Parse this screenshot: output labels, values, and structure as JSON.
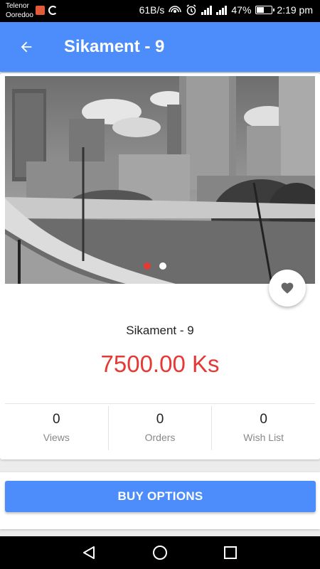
{
  "status_bar": {
    "carrier_line1": "Telenor",
    "carrier_line2": "Ooredoo",
    "net_speed": "61B/s",
    "battery_percent": "47%",
    "time": "2:19 pm"
  },
  "app_bar": {
    "title": "Sikament - 9",
    "back_icon": "arrow-back-icon"
  },
  "product": {
    "image_icon": "city-photo",
    "carousel": {
      "count": 2,
      "active_index": 0
    },
    "favorite_icon": "heart-icon",
    "name": "Sikament - 9",
    "price": "7500.00 Ks",
    "stats": [
      {
        "value": "0",
        "label": "Views"
      },
      {
        "value": "0",
        "label": "Orders"
      },
      {
        "value": "0",
        "label": "Wish List"
      }
    ]
  },
  "actions": {
    "buy_label": "BUY OPTIONS"
  },
  "nav": {
    "back_icon": "triangle-back-icon",
    "home_icon": "circle-home-icon",
    "recents_icon": "square-recents-icon"
  },
  "colors": {
    "primary": "#4c8dfb",
    "price": "#e53935",
    "active_dot": "#e53935"
  }
}
